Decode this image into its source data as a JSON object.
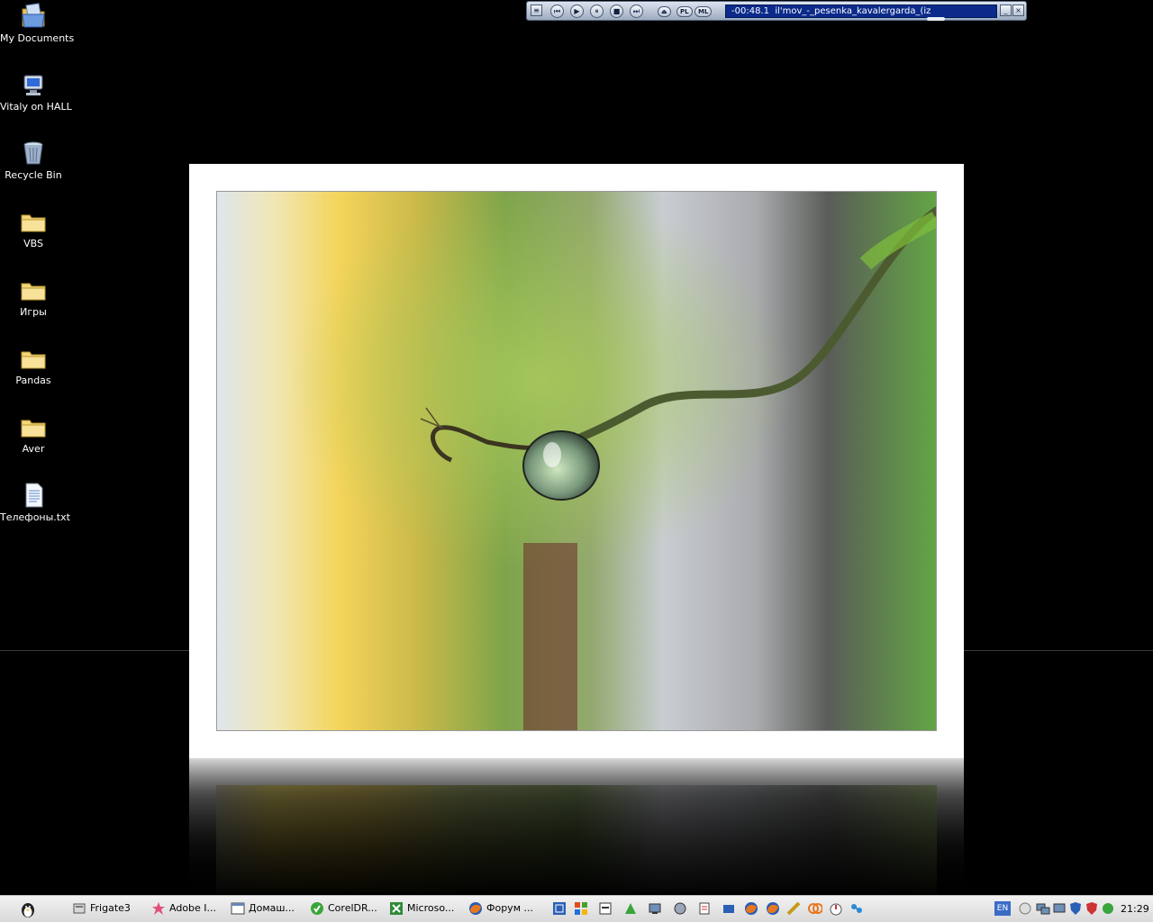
{
  "desktop": {
    "icons": [
      {
        "label": "My Documents",
        "icon": "my-documents-icon"
      },
      {
        "label": "Vitaly on HALL",
        "icon": "network-computer-icon"
      },
      {
        "label": "Recycle Bin",
        "icon": "recycle-bin-icon"
      },
      {
        "label": "VBS",
        "icon": "folder-icon"
      },
      {
        "label": "Игры",
        "icon": "folder-icon"
      },
      {
        "label": "Pandas",
        "icon": "folder-icon"
      },
      {
        "label": "Aver",
        "icon": "folder-icon"
      },
      {
        "label": "Телефоны.txt",
        "icon": "text-file-icon"
      }
    ]
  },
  "player": {
    "time": "-00:48.1",
    "track": "il'mov_-_pesenka_kavalergarda_(iz",
    "pl_label": "PL",
    "ml_label": "ML"
  },
  "taskbar": {
    "tasks": [
      {
        "label": "Frigate3",
        "icon": "frigate-icon"
      },
      {
        "label": "Adobe I...",
        "icon": "adobe-illustrator-icon"
      },
      {
        "label": "Домаш...",
        "icon": "window-icon"
      },
      {
        "label": "CorelDR...",
        "icon": "coreldraw-icon"
      },
      {
        "label": "Microso...",
        "icon": "excel-icon"
      },
      {
        "label": "Форум ...",
        "icon": "firefox-icon"
      }
    ],
    "language": "EN",
    "clock": "21:29"
  },
  "colors": {
    "desktop_bg": "#000000",
    "taskbar_bg": "#e6e6e6",
    "player_display": "#0b2a8a"
  }
}
